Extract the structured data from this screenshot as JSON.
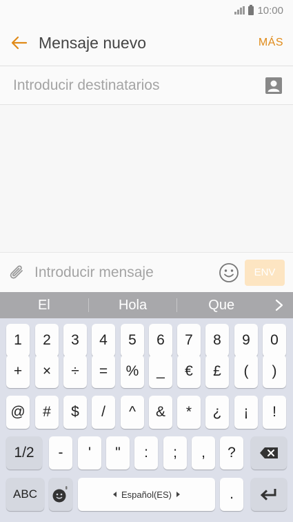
{
  "status": {
    "time": "10:00"
  },
  "header": {
    "title": "Mensaje nuevo",
    "more": "MÁS"
  },
  "recipients": {
    "placeholder": "Introducir destinatarios"
  },
  "composer": {
    "placeholder": "Introducir mensaje",
    "send": "ENV"
  },
  "suggestions": [
    "El",
    "Hola",
    "Que"
  ],
  "keyboard": {
    "row1": [
      "1",
      "2",
      "3",
      "4",
      "5",
      "6",
      "7",
      "8",
      "9",
      "0"
    ],
    "row2": [
      "+",
      "×",
      "÷",
      "=",
      "%",
      "_",
      "€",
      "£",
      "(",
      ")"
    ],
    "row3": [
      "@",
      "#",
      "$",
      "/",
      "^",
      "&",
      "*",
      "¿",
      "¡",
      "!"
    ],
    "row4": [
      "1/2",
      "-",
      "'",
      "\"",
      ":",
      ";",
      ",",
      "?"
    ],
    "abc": "ABC",
    "language": "Español(ES)",
    "period": "."
  },
  "colors": {
    "accent": "#e08a18",
    "send_disabled": "#fde5c2",
    "keyboard_bg": "#dde0ea",
    "suggestion_bar": "#a8a8ab"
  }
}
